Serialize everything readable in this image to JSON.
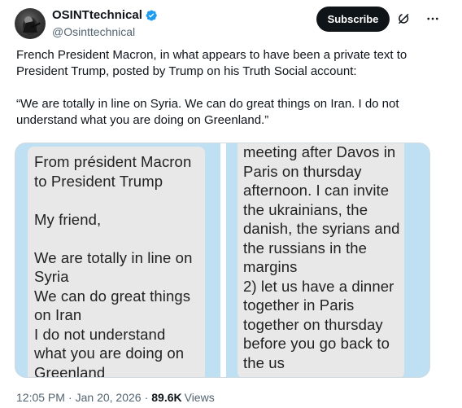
{
  "author": {
    "display_name": "OSINTtechnical",
    "handle": "@Osinttechnical",
    "verified": true,
    "avatar_icon": "avatar-image"
  },
  "actions": {
    "subscribe_label": "Subscribe",
    "grok_icon": "grok-icon",
    "more_icon": "more-icon"
  },
  "tweet": {
    "paragraph_1": "French President Macron, in what appears to have been a private text to President Trump, posted by Trump on his Truth Social account:",
    "paragraph_2": "“We are totally in line on Syria. We can do great things on Iran. I do not understand what you are doing on Greenland.”"
  },
  "media": {
    "left_text": "From président Macron\nto President Trump\n\nMy friend,\n\nWe are totally in line on\nSyria\nWe can do great things\non Iran\nI do not understand\nwhat you are doing on\nGreenland",
    "right_text": "meeting after Davos in\nParis on thursday\nafternoon. I can invite\nthe ukrainians, the\ndanish, the syrians and\nthe russians in the\nmargins\n2) let us have a dinner\ntogether in Paris\ntogether on thursday\nbefore you go back to\nthe us"
  },
  "meta": {
    "time": "12:05 PM",
    "separator": "·",
    "date": "Jan 20, 2026",
    "views_count": "89.6K",
    "views_label": "Views"
  },
  "colors": {
    "accent": "#1d9bf0",
    "text_primary": "#0f1419",
    "text_secondary": "#536471",
    "media_background": "#bfe0f3",
    "bubble_background": "#e8e8e8"
  }
}
